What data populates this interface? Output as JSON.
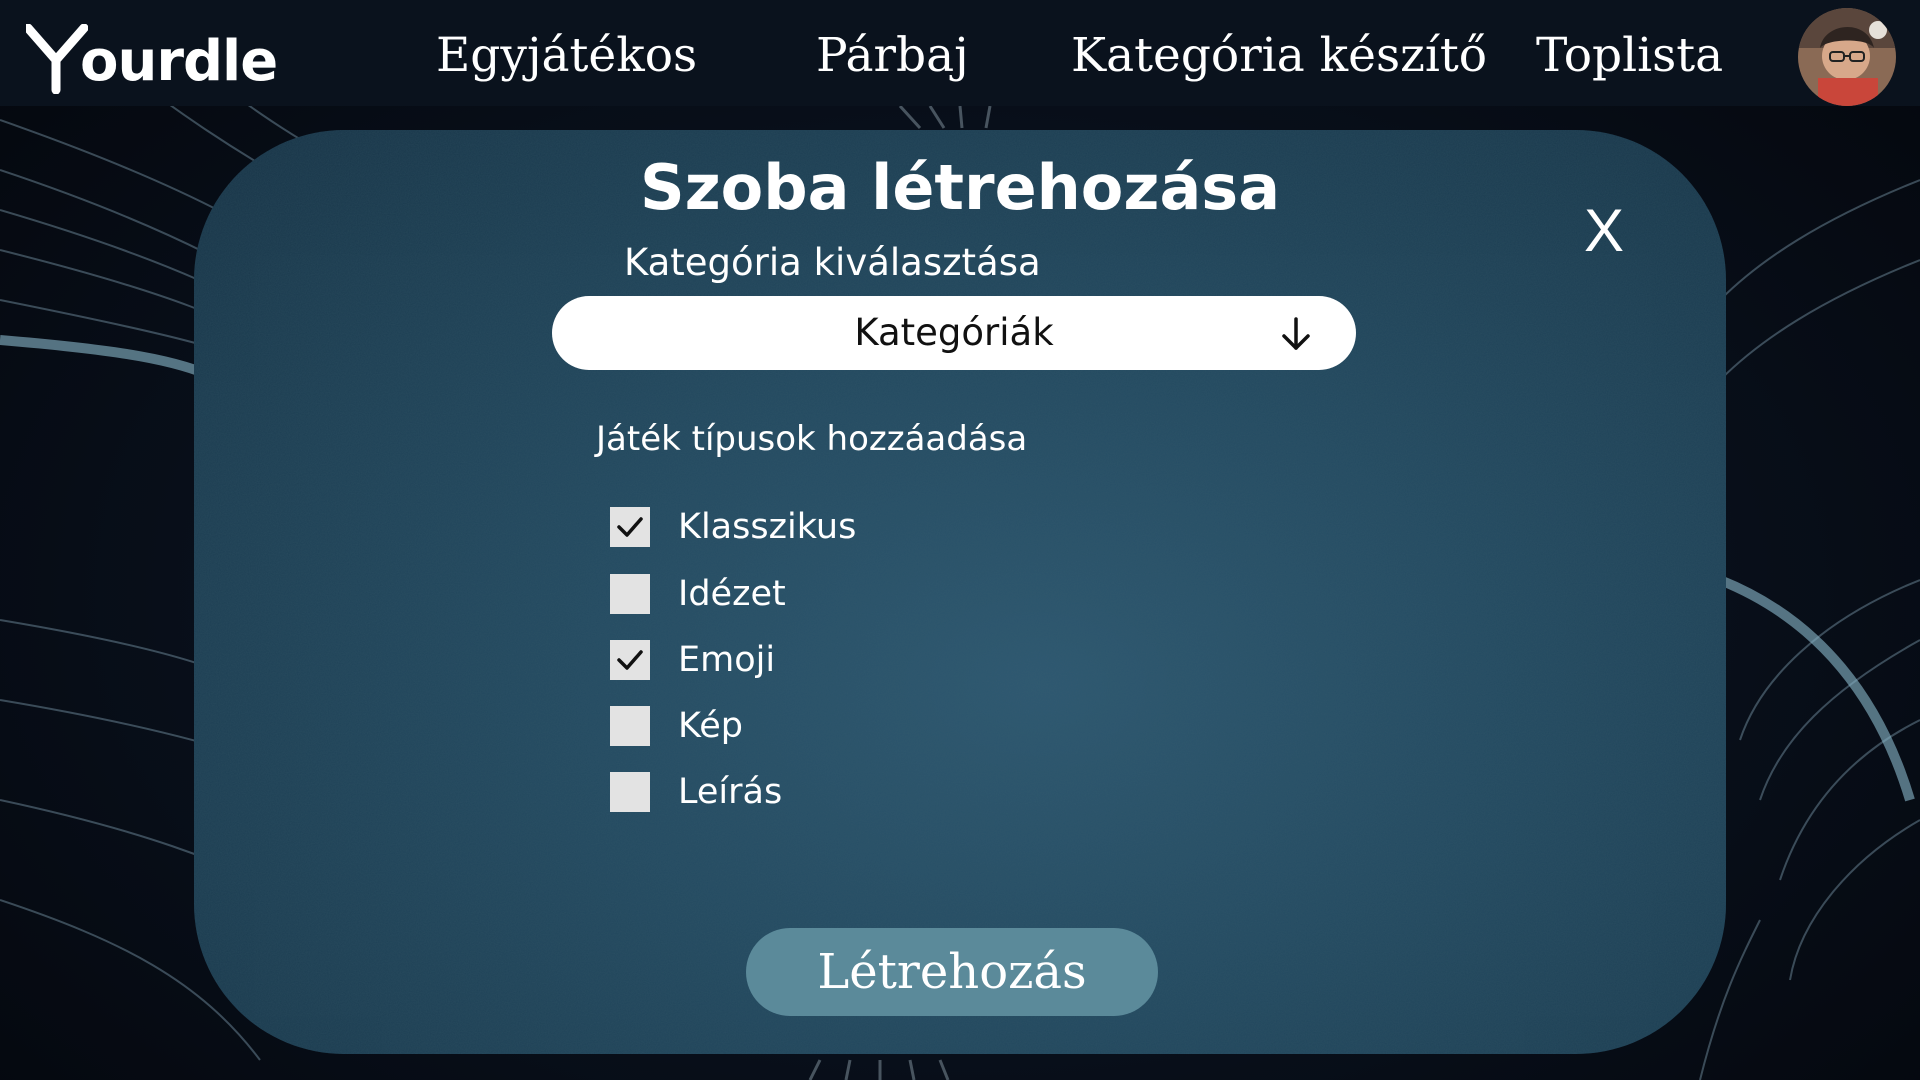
{
  "brand": {
    "logo_text": "ourdle"
  },
  "nav": {
    "items": [
      "Egyjátékos",
      "Párbaj",
      "Kategória készítő",
      "Toplista"
    ]
  },
  "modal": {
    "title": "Szoba létrehozása",
    "close_label": "X",
    "category_label": "Kategória kiválasztása",
    "category_dropdown_value": "Kategóriák",
    "game_types_label": "Játék típusok hozzáadása",
    "game_types": [
      {
        "label": "Klasszikus",
        "checked": true
      },
      {
        "label": "Idézet",
        "checked": false
      },
      {
        "label": "Emoji",
        "checked": true
      },
      {
        "label": "Kép",
        "checked": false
      },
      {
        "label": "Leírás",
        "checked": false
      }
    ],
    "create_button_label": "Létrehozás"
  },
  "colors": {
    "modal_bg": "#234a61",
    "button_bg": "#5b8a9a",
    "topbar_bg": "#0a121d",
    "checkbox_bg": "#e3e3e3"
  },
  "icons": {
    "logo": "y-chevron-logo",
    "dropdown": "arrow-down-icon",
    "check": "checkmark-icon",
    "avatar": "user-avatar"
  }
}
